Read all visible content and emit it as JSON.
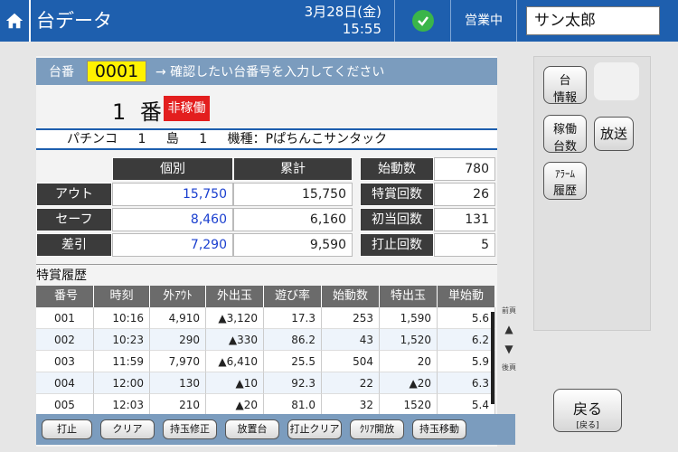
{
  "header": {
    "title": "台データ",
    "date": "3月28日(金)",
    "time": "15:55",
    "status": "営業中",
    "user": "サン太郎"
  },
  "machine": {
    "number_label": "台番",
    "number_value": "0001",
    "hint": "→ 確認したい台番号を入力してください",
    "display_no": "1 番",
    "badge": "非稼働",
    "type": "パチンコ",
    "island_num": "1",
    "island_label": "島",
    "seat_num": "1",
    "model": "機種：Pぱちんこサンタック"
  },
  "summary": {
    "col_individual": "個別",
    "col_total": "累計",
    "rows": [
      {
        "label": "アウト",
        "individual": "15,750",
        "total": "15,750"
      },
      {
        "label": "セーフ",
        "individual": "8,460",
        "total": "6,160"
      },
      {
        "label": "差引",
        "individual": "7,290",
        "total": "9,590"
      }
    ],
    "stats": [
      {
        "label": "始動数",
        "value": "780"
      },
      {
        "label": "特賞回数",
        "value": "26"
      },
      {
        "label": "初当回数",
        "value": "131"
      },
      {
        "label": "打止回数",
        "value": "5"
      }
    ]
  },
  "history": {
    "title": "特賞履歴",
    "headers": [
      "番号",
      "時刻",
      "外ｱｳﾄ",
      "外出玉",
      "遊び率",
      "始動数",
      "特出玉",
      "単始動"
    ],
    "rows": [
      [
        "001",
        "10:16",
        "4,910",
        "▲3,120",
        "17.3",
        "253",
        "1,590",
        "5.6"
      ],
      [
        "002",
        "10:23",
        "290",
        "▲330",
        "86.2",
        "43",
        "1,520",
        "6.2"
      ],
      [
        "003",
        "11:59",
        "7,970",
        "▲6,410",
        "25.5",
        "504",
        "20",
        "5.9"
      ],
      [
        "004",
        "12:00",
        "130",
        "▲10",
        "92.3",
        "22",
        "▲20",
        "6.3"
      ],
      [
        "005",
        "12:03",
        "210",
        "▲20",
        "81.0",
        "32",
        "1520",
        "5.4"
      ]
    ],
    "prev_page": "前頁",
    "next_page": "後頁"
  },
  "buttons": [
    "打止",
    "クリア",
    "持玉修正",
    "放置台",
    "打止クリア",
    "ｸﾘｱ開放",
    "持玉移動"
  ],
  "side": {
    "info_l1": "台",
    "info_l2": "情報",
    "rate_l1": "稼働",
    "rate_l2": "台数",
    "broadcast": "放送",
    "alarm_l1": "ｱﾗｰﾑ",
    "alarm_l2": "履歴",
    "back": "戻る",
    "back_sub": "[戻る]"
  }
}
